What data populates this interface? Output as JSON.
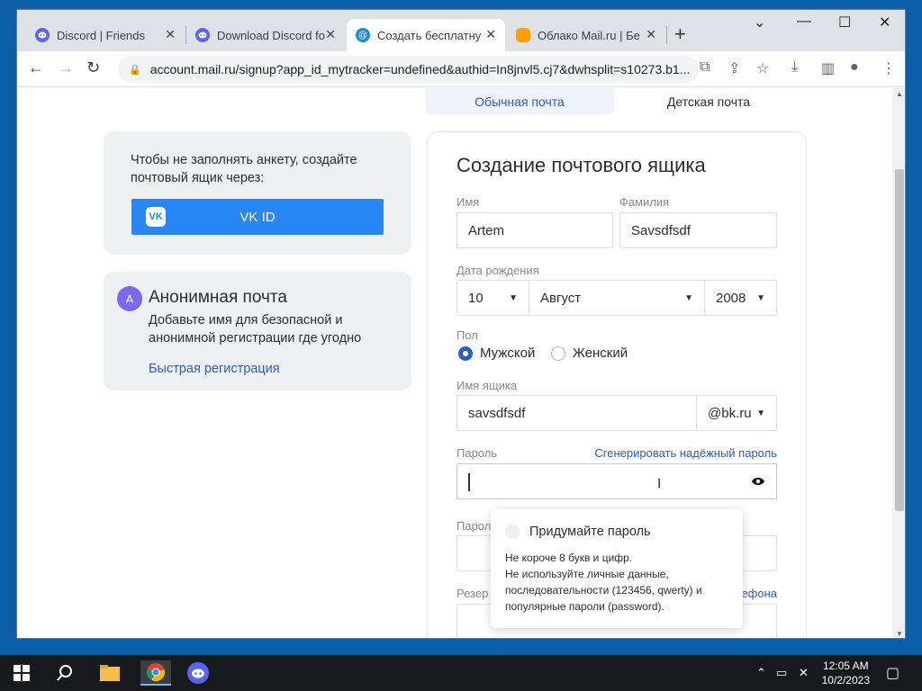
{
  "browser": {
    "tabs": [
      {
        "title": "Discord | Friends",
        "active": false
      },
      {
        "title": "Download Discord fo",
        "active": false
      },
      {
        "title": "Создать бесплатну",
        "active": true
      },
      {
        "title": "Облако Mail.ru | Бе",
        "active": false
      }
    ],
    "url": "account.mail.ru/signup?app_id_mytracker=undefined&authid=In8jnvl5.cj7&dwhsplit=s10273.b1..."
  },
  "page": {
    "top_tabs": {
      "regular": "Обычная почта",
      "kids": "Детская почта"
    },
    "vk_card": {
      "text": "Чтобы не заполнять анкету, создайте почтовый ящик через:",
      "button": "VK ID",
      "logo": "VK"
    },
    "anon_card": {
      "avatar": "A",
      "heading": "Анонимная почта",
      "desc": "Добавьте имя для безопасной и анонимной регистрации где угодно",
      "link": "Быстрая регистрация"
    },
    "form": {
      "title": "Создание почтового ящика",
      "first_name_label": "Имя",
      "first_name_value": "Artem",
      "last_name_label": "Фамилия",
      "last_name_value": "Savsdfsdf",
      "dob_label": "Дата рождения",
      "dob_day": "10",
      "dob_month": "Август",
      "dob_year": "2008",
      "gender_label": "Пол",
      "gender_male": "Мужской",
      "gender_female": "Женский",
      "mailbox_label": "Имя ящика",
      "mailbox_value": "savsdfsdf",
      "domain": "@bk.ru",
      "password_label": "Пароль",
      "generate_link": "Сгенерировать надёжный пароль",
      "repeat_label_partial": "Парол",
      "reserve_label_partial": "Резер",
      "phone_partial": "ефона"
    },
    "tooltip": {
      "title": "Придумайте пароль",
      "line1": "Не короче 8 букв и цифр.",
      "line2": "Не используйте личные данные, последовательности (123456, qwerty) и популярные пароли (password)."
    }
  },
  "taskbar": {
    "time": "12:05 AM",
    "date": "10/2/2023"
  }
}
